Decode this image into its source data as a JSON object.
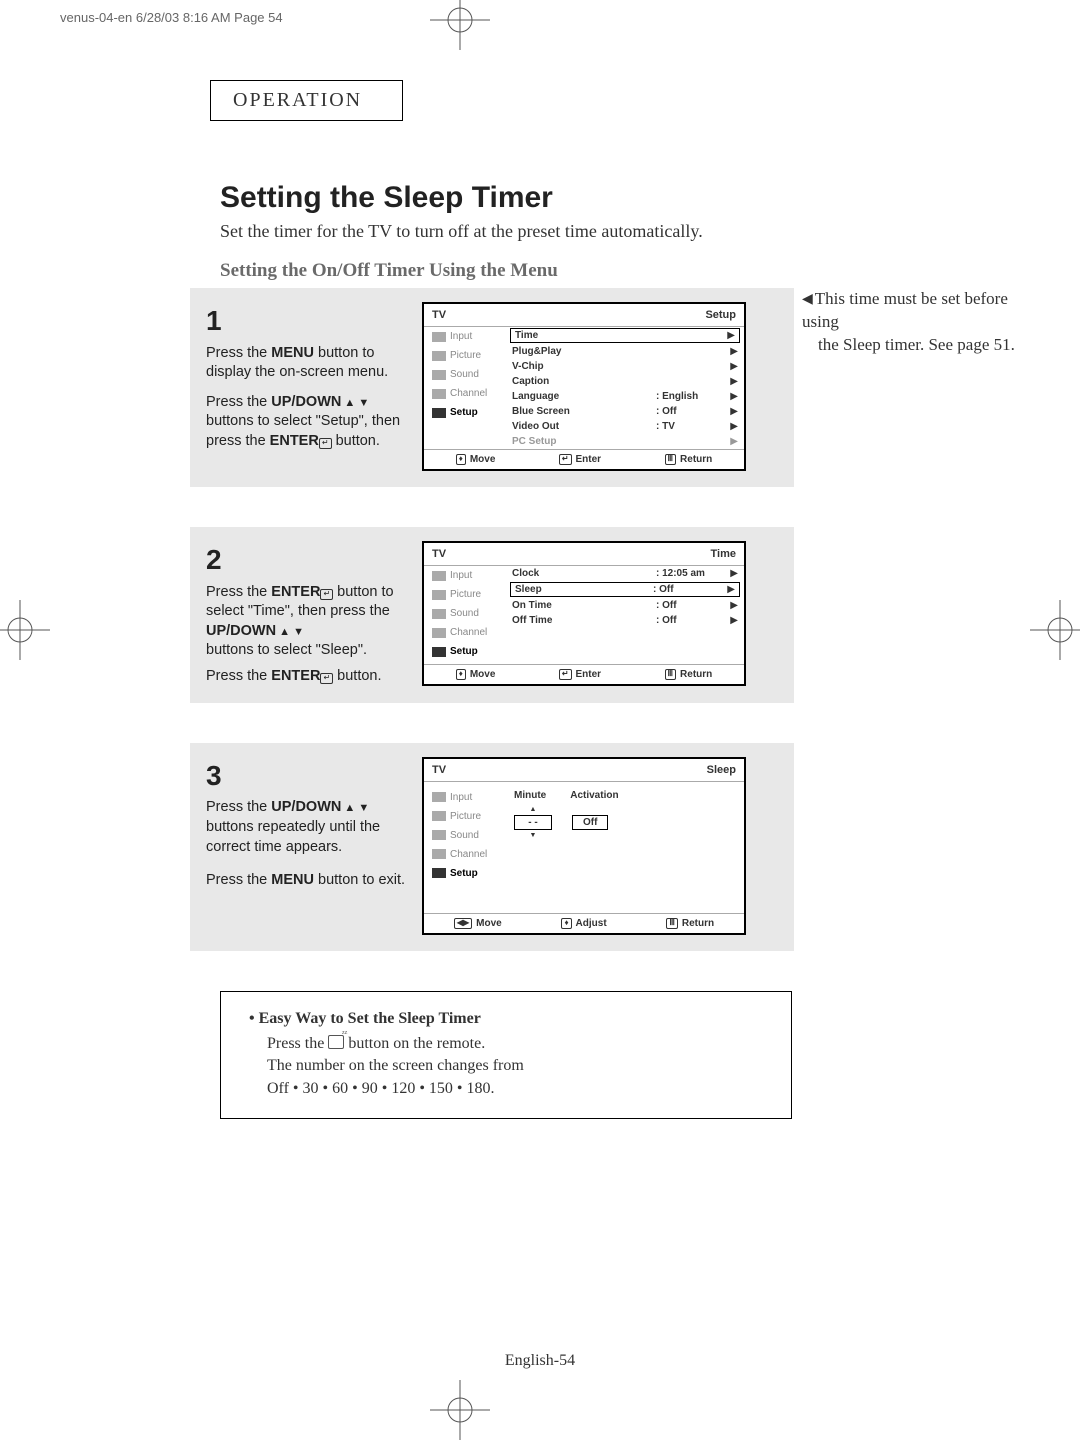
{
  "print_header": "venus-04-en  6/28/03  8:16 AM  Page 54",
  "operation_label": "OPERATION",
  "title": "Setting the Sleep Timer",
  "intro": "Set the timer for the TV to turn off at the preset time automatically.",
  "subhead": "Setting the On/Off  Timer Using the Menu",
  "side_note_l1": "This time must be set before using",
  "side_note_l2": "the Sleep timer. See page 51.",
  "step1": {
    "num": "1",
    "p1a": "Press the ",
    "p1b": "MENU",
    "p1c": " button to display the on-screen menu.",
    "p2a": "Press the ",
    "p2b": "UP/DOWN",
    "p2c": " buttons to select \"Setup\", then press the ",
    "p2d": "ENTER",
    "p2e": " button."
  },
  "step2": {
    "num": "2",
    "p1a": "Press the ",
    "p1b": "ENTER",
    "p1c": " button to select \"Time\", then press the ",
    "p1d": "UP/DOWN",
    "p1e": " buttons to select  \"Sleep\".",
    "p2a": "Press the ",
    "p2b": "ENTER",
    "p2c": " button."
  },
  "step3": {
    "num": "3",
    "p1a": "Press the ",
    "p1b": "UP/DOWN",
    "p1c": " buttons repeatedly until the correct time appears.",
    "p2a": "Press the ",
    "p2b": "MENU",
    "p2c": " button to exit."
  },
  "osd": {
    "tv": "TV",
    "sidebar": {
      "input": "Input",
      "picture": "Picture",
      "sound": "Sound",
      "channel": "Channel",
      "setup": "Setup"
    },
    "setup": {
      "title": "Setup",
      "rows": [
        {
          "label": "Time",
          "val": "",
          "boxed": true
        },
        {
          "label": "Plug&Play",
          "val": ""
        },
        {
          "label": "V-Chip",
          "val": ""
        },
        {
          "label": "Caption",
          "val": ""
        },
        {
          "label": "Language",
          "val": ":   English"
        },
        {
          "label": "Blue Screen",
          "val": ":   Off"
        },
        {
          "label": "Video Out",
          "val": ":   TV"
        },
        {
          "label": "PC Setup",
          "val": "",
          "dis": true
        }
      ]
    },
    "time": {
      "title": "Time",
      "rows": [
        {
          "label": "Clock",
          "val": ":   12:05 am"
        },
        {
          "label": "Sleep",
          "val": ":   Off",
          "boxed": true
        },
        {
          "label": "On Time",
          "val": ":   Off"
        },
        {
          "label": "Off Time",
          "val": ":   Off"
        }
      ]
    },
    "sleep": {
      "title": "Sleep",
      "h_min": "Minute",
      "h_act": "Activation",
      "v_min": "- -",
      "v_act": "Off"
    },
    "footer": {
      "move": "Move",
      "enter": "Enter",
      "return": "Return",
      "adjust": "Adjust"
    }
  },
  "easy": {
    "title": "Easy Way to Set the Sleep Timer",
    "l1a": "Press the ",
    "l1b": " button on the remote.",
    "l2": "The number on the screen changes from",
    "l3": "Off • 30  • 60  • 90 • 120 • 150 • 180."
  },
  "page_num": "English-54"
}
